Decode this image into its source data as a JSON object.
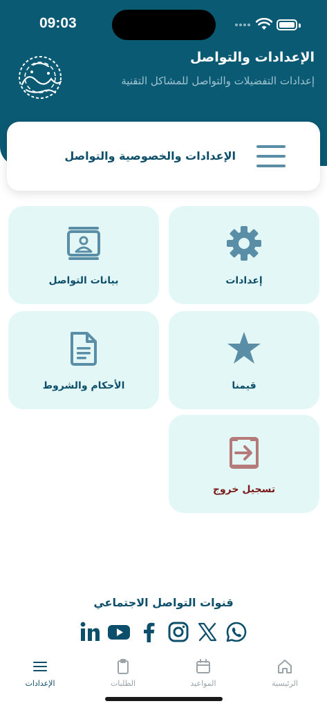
{
  "status_bar": {
    "time": "09:03"
  },
  "header": {
    "title": "الإعدادات والتواصل",
    "subtitle": "إعدادات التفضيلات والتواصل للمشاكل التقنية"
  },
  "card": {
    "title": "الإعدادات والخصوصية والتواصل"
  },
  "tiles": {
    "settings": {
      "label": "إعدادات",
      "icon": "gear-icon"
    },
    "contact": {
      "label": "بيانات التواصل",
      "icon": "contact-card-icon"
    },
    "rate": {
      "label": "قيمنا",
      "icon": "star-icon"
    },
    "terms": {
      "label": "الأحكام والشروط",
      "icon": "document-icon"
    },
    "logout": {
      "label": "تسجيل خروج",
      "icon": "logout-icon"
    }
  },
  "social": {
    "title": "قنوات التواصل الاجتماعي",
    "icons": [
      "linkedin-icon",
      "youtube-icon",
      "facebook-icon",
      "instagram-icon",
      "x-icon",
      "whatsapp-icon"
    ]
  },
  "tabbar": {
    "home": "الرئيسية",
    "appointments": "المواعيد",
    "requests": "الطلبات",
    "settings": "الإعدادات"
  },
  "colors": {
    "header_bg": "#0b5a74",
    "tile_bg": "#e3f7f7",
    "primary_text": "#0d4f6a",
    "icon_fill": "#5a8ea6",
    "logout_text": "#7a1a1a",
    "logout_icon": "#b57a7a"
  }
}
